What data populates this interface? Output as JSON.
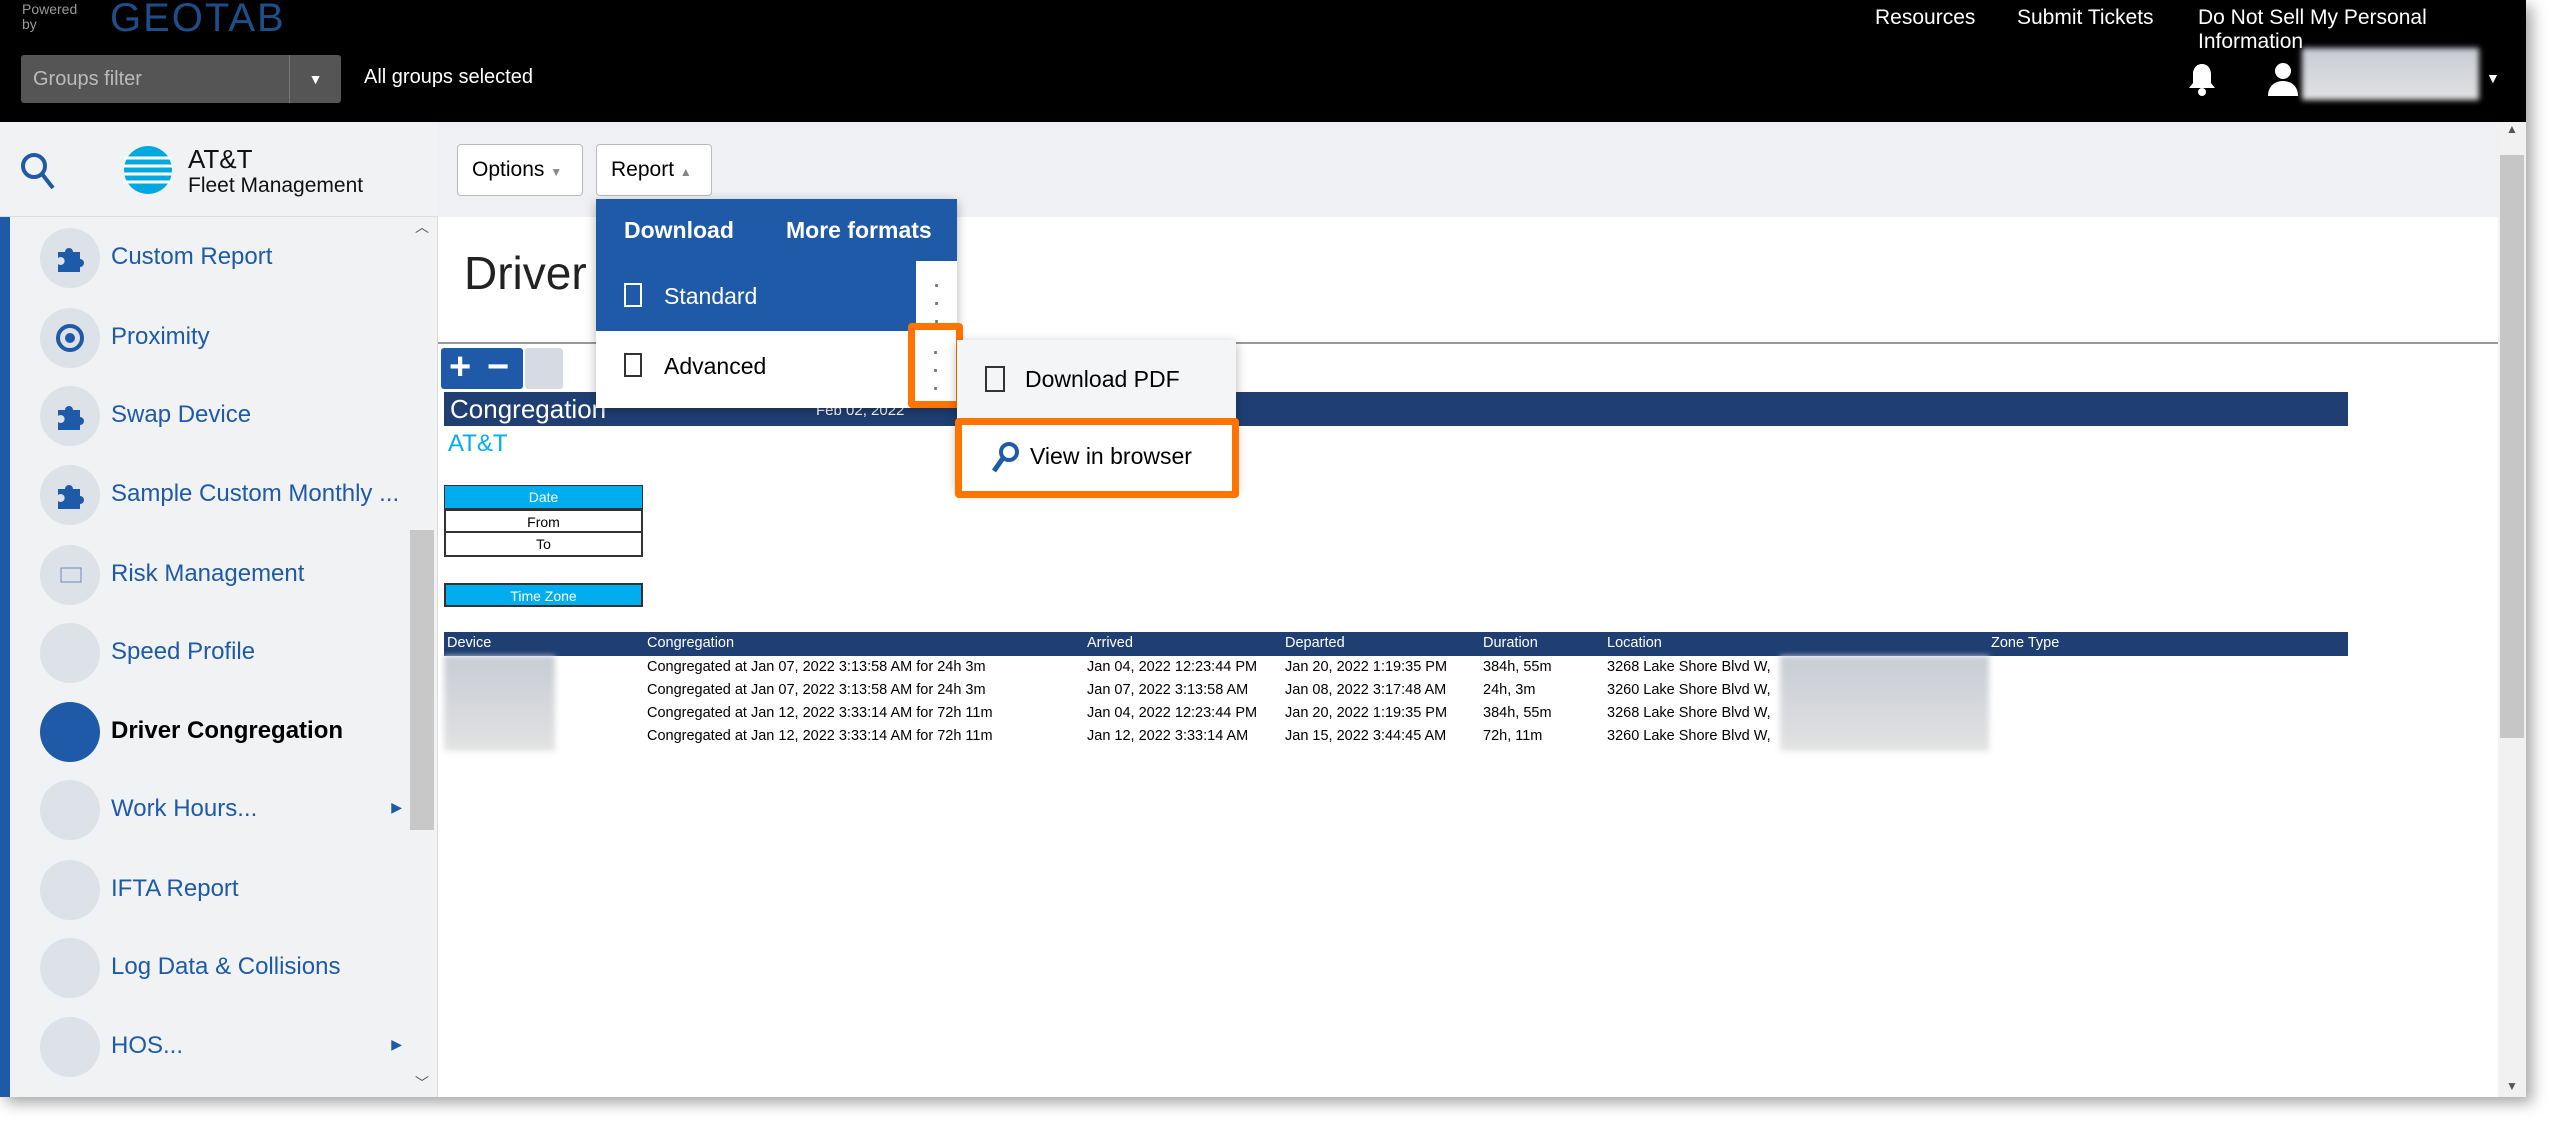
{
  "header": {
    "powered_by": "Powered by",
    "brand": "GEOTAB",
    "groups_filter_placeholder": "Groups filter",
    "groups_status": "All groups selected",
    "links": [
      "Resources",
      "Submit Tickets",
      "Do Not Sell My Personal Information"
    ]
  },
  "logo": {
    "line1": "AT&T",
    "line2": "Fleet Management"
  },
  "sidebar": {
    "items": [
      {
        "label": "Custom Report",
        "icon": "puzzle-icon"
      },
      {
        "label": "Proximity",
        "icon": "proximity-icon"
      },
      {
        "label": "Swap Device",
        "icon": "puzzle-icon"
      },
      {
        "label": "Sample Custom Monthly ...",
        "icon": "puzzle-icon"
      },
      {
        "label": "Risk Management",
        "icon": "chart-icon"
      },
      {
        "label": "Speed Profile",
        "icon": ""
      },
      {
        "label": "Driver Congregation",
        "icon": "",
        "active": true
      },
      {
        "label": "Work Hours...",
        "icon": "",
        "submenu": true
      },
      {
        "label": "IFTA Report",
        "icon": ""
      },
      {
        "label": "Log Data & Collisions",
        "icon": ""
      },
      {
        "label": "HOS...",
        "icon": "",
        "submenu": true
      }
    ]
  },
  "toolbar": {
    "options": "Options",
    "report": "Report"
  },
  "page_title": "Driver C",
  "report_menu": {
    "download": "Download",
    "more_formats": "More formats",
    "standard": "Standard",
    "advanced": "Advanced"
  },
  "submenu": {
    "download_pdf": "Download PDF",
    "view_in_browser": "View in browser"
  },
  "report": {
    "title": "Congregation",
    "date": "Feb 02, 2022",
    "company": "AT&T",
    "date_label": "Date",
    "from_label": "From",
    "to_label": "To",
    "timezone_label": "Time Zone",
    "columns": [
      "Device",
      "Congregation",
      "Arrived",
      "Departed",
      "Duration",
      "Location",
      "Zone Type"
    ],
    "rows": [
      [
        "Congregated at Jan 07, 2022 3:13:58 AM for 24h 3m",
        "Jan 04, 2022 12:23:44 PM",
        "Jan 20, 2022 1:19:35 PM",
        "384h, 55m",
        "3268 Lake Shore Blvd W,"
      ],
      [
        "Congregated at Jan 07, 2022 3:13:58 AM for 24h 3m",
        "Jan 07, 2022 3:13:58 AM",
        "Jan 08, 2022 3:17:48 AM",
        "24h, 3m",
        "3260 Lake Shore Blvd W,"
      ],
      [
        "Congregated at Jan 12, 2022 3:33:14 AM for 72h 11m",
        "Jan 04, 2022 12:23:44 PM",
        "Jan 20, 2022 1:19:35 PM",
        "384h, 55m",
        "3268 Lake Shore Blvd W,"
      ],
      [
        "Congregated at Jan 12, 2022 3:33:14 AM for 72h 11m",
        "Jan 12, 2022 3:33:14 AM",
        "Jan 15, 2022 3:44:45 AM",
        "72h, 11m",
        "3260 Lake Shore Blvd W,"
      ]
    ]
  },
  "colors": {
    "accent": "#1e5aa8",
    "highlight": "#ff7300",
    "report_band": "#1f3f73",
    "cyan": "#00aeef"
  }
}
